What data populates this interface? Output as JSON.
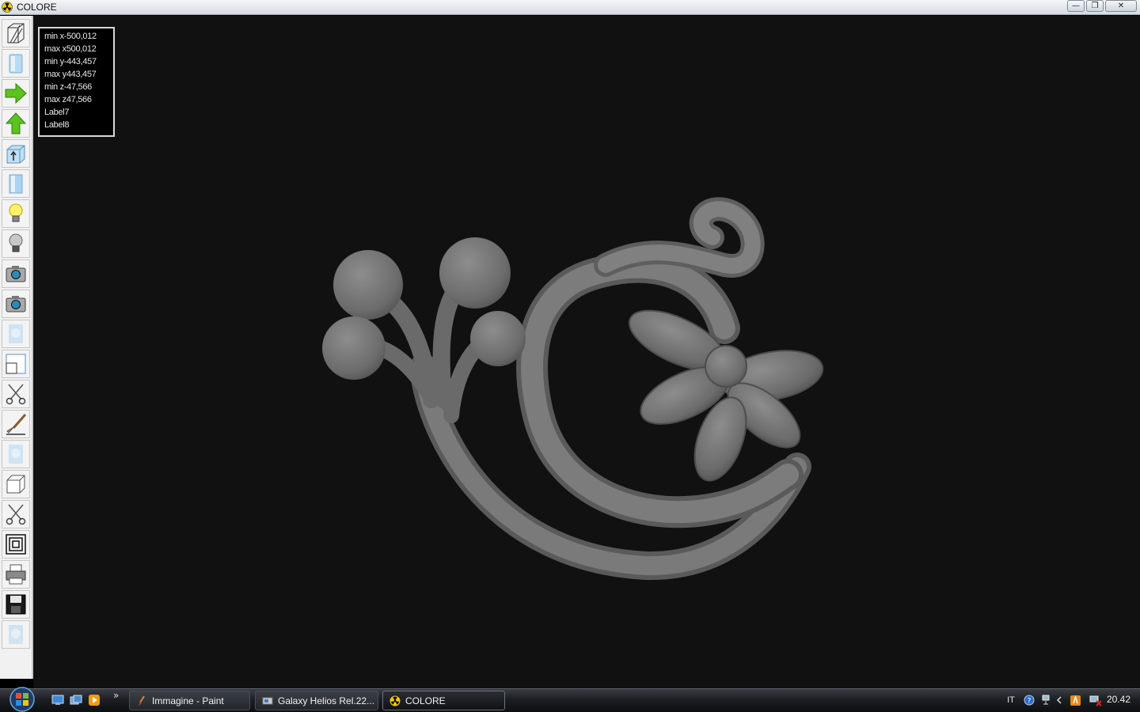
{
  "window": {
    "title": "COLORE",
    "minimize_label": "—",
    "restore_label": "❐",
    "close_label": "✕"
  },
  "toolbar": {
    "tools": [
      "wireframe-icon",
      "solid-view-icon",
      "arrow-right-icon",
      "arrow-up-icon",
      "extrude-icon",
      "panel-icon",
      "light-on-icon",
      "light-off-icon",
      "camera-icon",
      "camera-alt-icon",
      "texture-icon",
      "view-window-icon",
      "scissors-icon",
      "brush-icon",
      "texture-2-icon",
      "box-icon",
      "scissors-2-icon",
      "offset-icon",
      "printer-icon",
      "save-icon",
      "texture-3-icon"
    ]
  },
  "info": {
    "lines": [
      "min x-500,012",
      "max x500,012",
      "min y-443,457",
      "max y443,457",
      "min z-47,566",
      "max z47,566",
      "Label7",
      "Label8"
    ]
  },
  "taskbar": {
    "quicklaunch_more": "»",
    "tasks": [
      {
        "label": "Immagine - Paint"
      },
      {
        "label": "Galaxy Helios  Rel.22..."
      },
      {
        "label": "COLORE"
      }
    ],
    "language": "IT",
    "clock": "20.42"
  }
}
